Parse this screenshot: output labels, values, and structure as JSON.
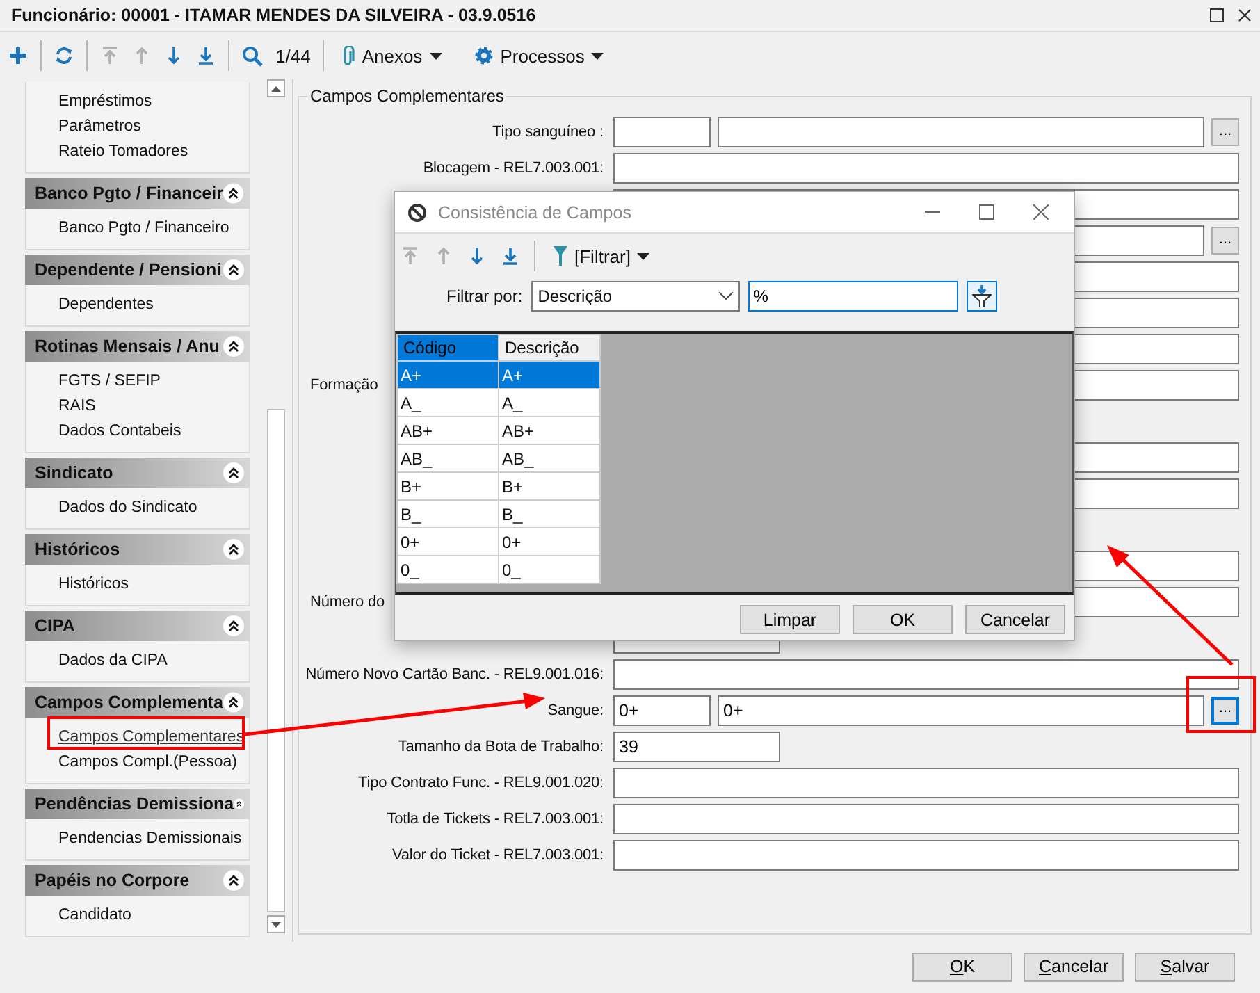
{
  "window": {
    "title": "Funcionário: 00001 - ITAMAR MENDES DA SILVEIRA - 03.9.0516"
  },
  "toolbar": {
    "nav": [
      {
        "kind": "add",
        "disabled": false
      },
      {
        "kind": "refresh",
        "disabled": false
      },
      {
        "kind": "first",
        "disabled": true
      },
      {
        "kind": "prev",
        "disabled": true
      },
      {
        "kind": "next",
        "disabled": false
      },
      {
        "kind": "last",
        "disabled": false
      }
    ],
    "counter": "1/44",
    "menus": [
      {
        "kind": "attach",
        "label": "Anexos"
      },
      {
        "kind": "gear",
        "label": "Processos"
      }
    ]
  },
  "sidebar": {
    "groups": [
      {
        "items": [
          {
            "label": "Empréstimos",
            "selected": false
          },
          {
            "label": "Parâmetros",
            "selected": false
          },
          {
            "label": "Rateio Tomadores",
            "selected": false
          }
        ]
      },
      {
        "title": "Banco Pgto / Financeir",
        "items": [
          {
            "label": "Banco Pgto / Financeiro",
            "selected": false
          }
        ]
      },
      {
        "title": "Dependente / Pensioni",
        "items": [
          {
            "label": "Dependentes",
            "selected": false
          }
        ]
      },
      {
        "title": "Rotinas Mensais / Anu",
        "items": [
          {
            "label": "FGTS / SEFIP",
            "selected": false
          },
          {
            "label": "RAIS",
            "selected": false
          },
          {
            "label": "Dados Contabeis",
            "selected": false
          }
        ]
      },
      {
        "title": "Sindicato",
        "items": [
          {
            "label": "Dados do Sindicato",
            "selected": false
          }
        ]
      },
      {
        "title": "Históricos",
        "items": [
          {
            "label": "Históricos",
            "selected": false
          }
        ]
      },
      {
        "title": "CIPA",
        "items": [
          {
            "label": "Dados da CIPA",
            "selected": false
          }
        ]
      },
      {
        "title": "Campos Complementa",
        "items": [
          {
            "label": "Campos Complementares",
            "selected": true
          },
          {
            "label": "Campos Compl.(Pessoa)",
            "selected": false
          }
        ]
      },
      {
        "title": "Pendências Demissiona",
        "items": [
          {
            "label": "Pendencias Demissionais",
            "selected": false
          }
        ]
      },
      {
        "title": "Papéis no Corpore",
        "items": [
          {
            "label": "Candidato",
            "selected": false
          }
        ]
      }
    ]
  },
  "form": {
    "title": "Campos Complementares",
    "rows": [
      {
        "kind": "field",
        "label": "Tipo sanguíneo :",
        "fields": [
          {
            "kind": "code"
          },
          {
            "kind": "text"
          }
        ],
        "lookup": {
          "label": "...",
          "focused": false
        }
      },
      {
        "kind": "field",
        "label": "Blocagem - REL7.003.001:",
        "fields": [
          {
            "kind": "text"
          }
        ]
      },
      {
        "kind": "field",
        "fields": [
          {
            "kind": "text"
          }
        ]
      },
      {
        "kind": "field",
        "fields": [
          {
            "kind": "text"
          }
        ],
        "lookup": {
          "label": "...",
          "focused": false
        }
      },
      {
        "kind": "field",
        "fields": [
          {
            "kind": "text"
          }
        ]
      },
      {
        "kind": "field",
        "fields": [
          {
            "kind": "text"
          }
        ]
      },
      {
        "kind": "field",
        "fields": [
          {
            "kind": "text"
          }
        ]
      },
      {
        "kind": "field_cut",
        "label": "Formação",
        "fields": [
          {
            "kind": "text"
          }
        ]
      },
      {
        "kind": "spacer"
      },
      {
        "kind": "field",
        "fields": [
          {
            "kind": "text"
          }
        ]
      },
      {
        "kind": "field",
        "fields": [
          {
            "kind": "text"
          }
        ]
      },
      {
        "kind": "spacer"
      },
      {
        "kind": "field",
        "fields": [
          {
            "kind": "text"
          }
        ]
      },
      {
        "kind": "field_cut",
        "label": "Número do",
        "fields": [
          {
            "kind": "text"
          }
        ]
      },
      {
        "kind": "field",
        "fields": [
          {
            "kind": "small"
          }
        ]
      },
      {
        "kind": "field",
        "label": "Número Novo Cartão Banc. - REL9.001.016:",
        "fields": [
          {
            "kind": "text"
          }
        ]
      },
      {
        "kind": "field",
        "label": "Sangue:",
        "fields": [
          {
            "kind": "code",
            "value": "0+"
          },
          {
            "kind": "text",
            "value": "0+"
          }
        ],
        "lookup": {
          "label": "...",
          "focused": true
        }
      },
      {
        "kind": "field",
        "label": "Tamanho da Bota de Trabalho:",
        "fields": [
          {
            "kind": "small",
            "value": "39"
          }
        ]
      },
      {
        "kind": "field",
        "label": "Tipo Contrato Func.  - REL9.001.020:",
        "fields": [
          {
            "kind": "text"
          }
        ]
      },
      {
        "kind": "field",
        "label": "Totla de Tickets -  REL7.003.001:",
        "fields": [
          {
            "kind": "text"
          }
        ]
      },
      {
        "kind": "field",
        "label": "Valor do Ticket  -  REL7.003.001:",
        "fields": [
          {
            "kind": "text"
          }
        ]
      }
    ]
  },
  "buttons": [
    "OK",
    "Cancelar",
    "Salvar"
  ],
  "dialog": {
    "title": "Consistência de Campos",
    "nav": [
      {
        "kind": "first",
        "disabled": true
      },
      {
        "kind": "prev",
        "disabled": true
      },
      {
        "kind": "next",
        "disabled": false
      },
      {
        "kind": "last",
        "disabled": false
      }
    ],
    "filter_menu": "[Filtrar]",
    "filter_label": "Filtrar por:",
    "filter_by": "Descrição",
    "filter_value": "%",
    "columns": [
      {
        "label": "Código",
        "selected": true
      },
      {
        "label": "Descrição",
        "selected": false
      }
    ],
    "rows": [
      {
        "cells": [
          "A+",
          "A+"
        ],
        "selected": true
      },
      {
        "cells": [
          "A_",
          "A_"
        ],
        "selected": false
      },
      {
        "cells": [
          "AB+",
          "AB+"
        ],
        "selected": false
      },
      {
        "cells": [
          "AB_",
          "AB_"
        ],
        "selected": false
      },
      {
        "cells": [
          "B+",
          "B+"
        ],
        "selected": false
      },
      {
        "cells": [
          "B_",
          "B_"
        ],
        "selected": false
      },
      {
        "cells": [
          "0+",
          "0+"
        ],
        "selected": false
      },
      {
        "cells": [
          "0_",
          "0_"
        ],
        "selected": false
      }
    ],
    "buttons": [
      "Limpar",
      "OK",
      "Cancelar"
    ]
  }
}
